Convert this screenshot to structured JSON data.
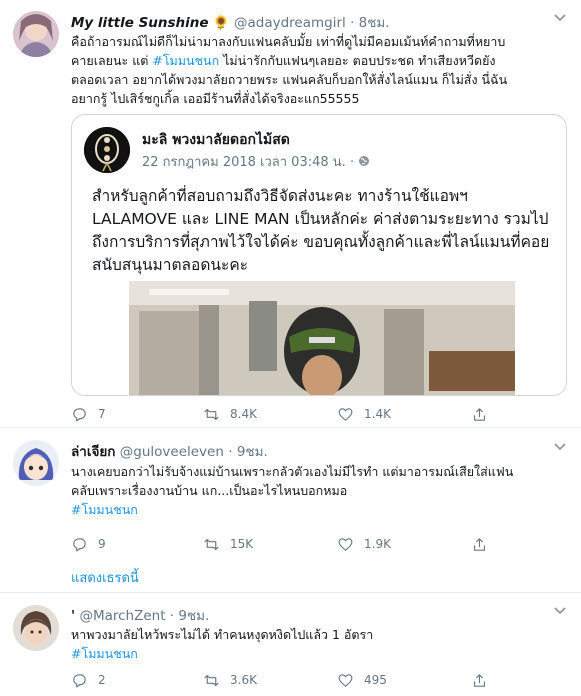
{
  "tweets": [
    {
      "name": "My little Sunshine",
      "emoji": "🌻",
      "handle": "@adaydreamgirl",
      "time": "8ชม.",
      "text_lines": [
        "คือถ้าอารมณ์ไม่ดีก็ไม่น่ามาลงกับแฟนคลับมั้ย เท่าที่ดูไม่มีคอมเม้นท์คำถามที่หยาบ",
        "คายเลยนะ แต่ ",
        "#โมมนชนก",
        " ไม่น่ารักกับแฟนๆเลยอะ ตอบประชด ทำเสียงหวีดยัง",
        "ตลอดเวลา อยากได้พวงมาลัยถวายพระ แฟนคลับก็บอกให้สั่งไลน์แมน ก็ไม่สั่ง นี่ฉัน",
        "อยากรู้ ไปเสิร์ชกูเกิ้ล เออมีร้านที่สั่งได้จริงอะแก55555"
      ],
      "quoted": {
        "name": "มะลิ พวงมาลัยดอกไม้สด",
        "date": "22 กรกฎาคม 2018 เวลา 03:48 น.",
        "separator": "·",
        "text": "สำหรับลูกค้าที่สอบถามถึงวิธีจัดส่งนะคะ ทางร้านใช้แอพฯ LALAMOVE และ LINE MAN เป็นหลักค่ะ ค่าส่งตามระยะทาง รวมไปถึงการบริการที่สุภาพไว้ใจได้ค่ะ ขอบคุณทั้งลูกค้าและพี่ไลน์แมนที่คอยสนับสนุนมาตลอดนะคะ"
      },
      "replies": "7",
      "retweets": "8.4K",
      "likes": "1.4K"
    },
    {
      "name": "ล่าเจียก",
      "handle": "@guloveeleven",
      "time": "9ชม.",
      "text_lines": [
        "นางเคยบอกว่าไม่รับจ้างแม่บ้านเพราะกลัวตัวเองไม่มีไรทำ แต่มาอารมณ์เสียใส่แฟน",
        "คลับเพราะเรื่องงานบ้าน แก...เป็นอะไรไหนบอกหมอ"
      ],
      "hashtag": "#โมมนชนก",
      "replies": "9",
      "retweets": "15K",
      "likes": "1.9K",
      "thread_link": "แสดงเธรดนี้"
    },
    {
      "name": "'",
      "handle": "@MarchZent",
      "time": "9ชม.",
      "text_lines": [
        "หาพวงมาลัยไหว้พระไม่ได้ ทำคนหงุดหงิดไปแล้ว 1 อัตรา"
      ],
      "hashtag": "#โมมนชนก",
      "replies": "2",
      "retweets": "3.6K",
      "likes": "495"
    }
  ],
  "separator": "·",
  "colors": {
    "link": "#1b95e0",
    "muted": "#657786",
    "border": "#e6ecf0"
  },
  "icons": [
    "reply-icon",
    "retweet-icon",
    "like-icon",
    "share-icon",
    "chevron-down-icon",
    "globe-icon"
  ]
}
